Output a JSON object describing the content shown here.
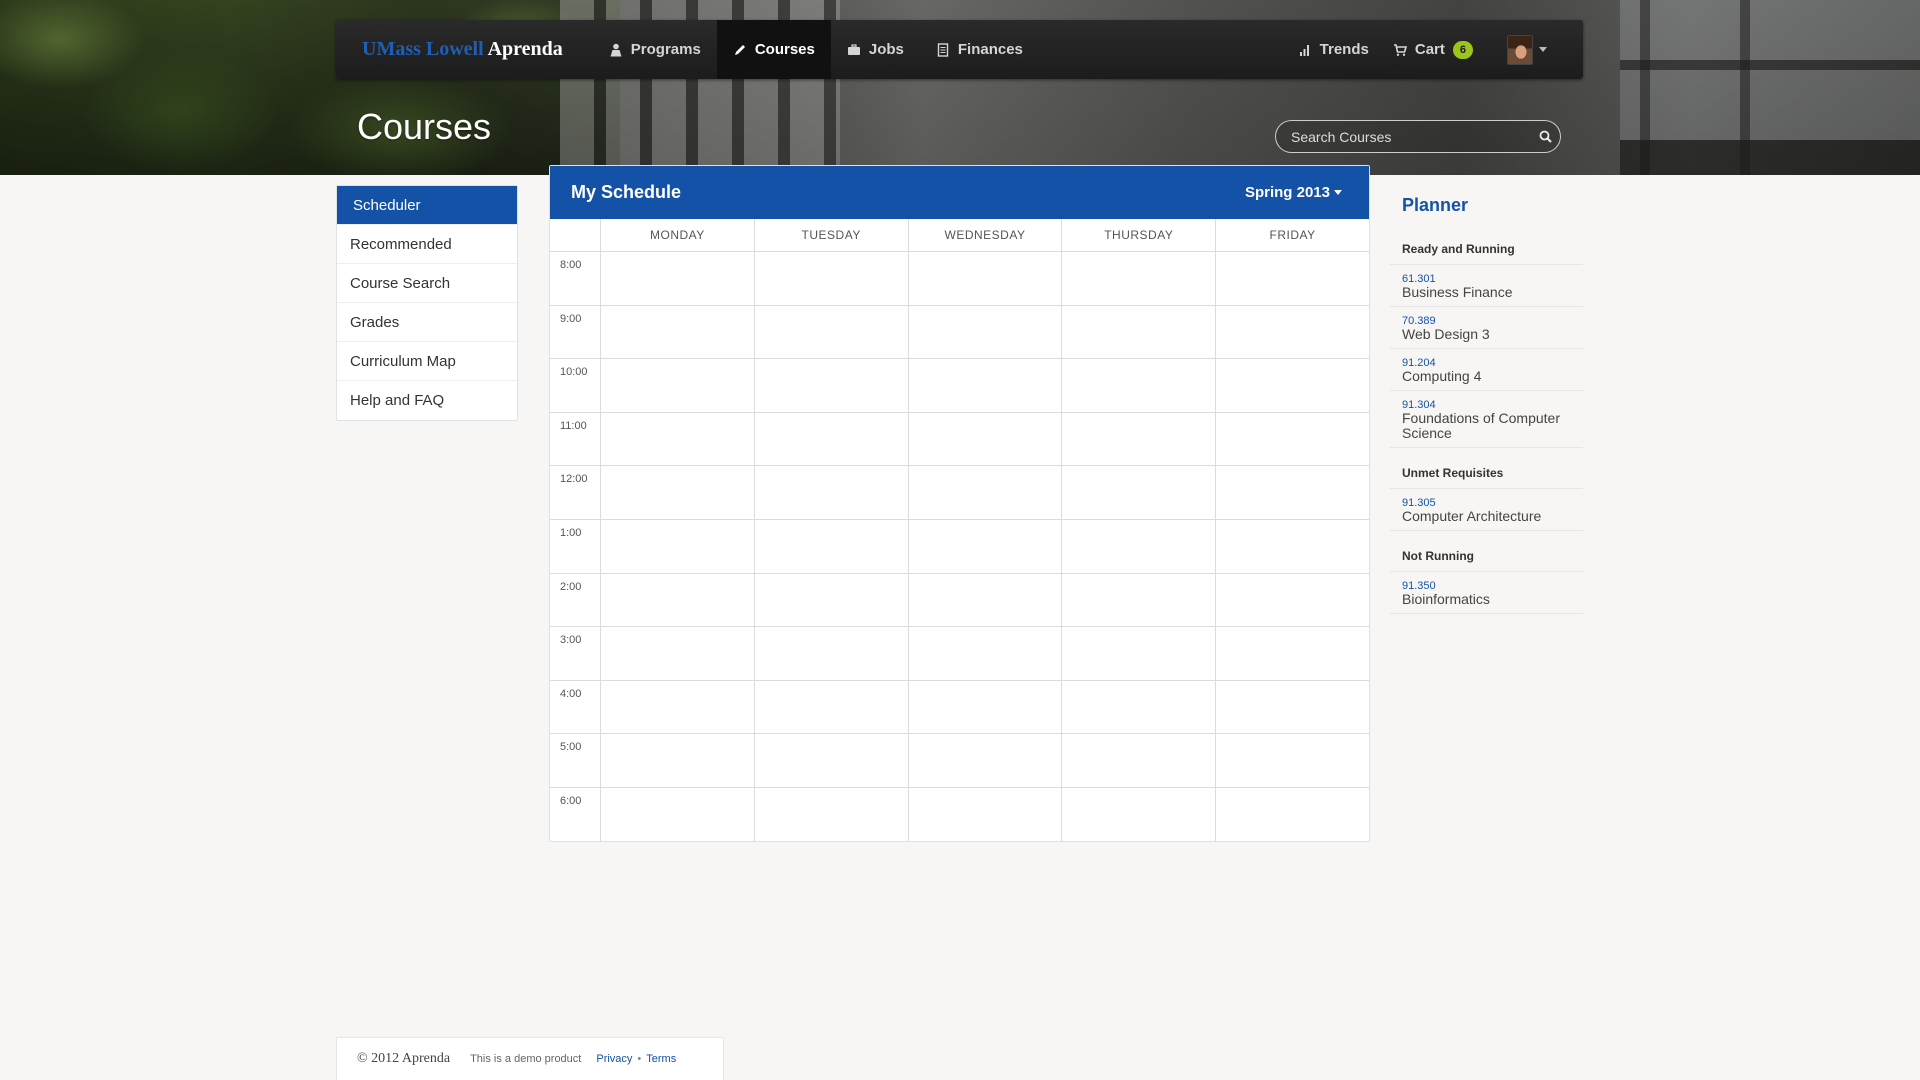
{
  "brand": {
    "part1": "UMass Lowell",
    "part2": "Aprenda"
  },
  "nav": {
    "items": [
      {
        "label": "Programs",
        "icon": "person-icon"
      },
      {
        "label": "Courses",
        "icon": "pencil-icon",
        "active": true
      },
      {
        "label": "Jobs",
        "icon": "briefcase-icon"
      },
      {
        "label": "Finances",
        "icon": "document-icon"
      }
    ],
    "right": {
      "trends": "Trends",
      "cart": "Cart",
      "cart_count": "6"
    }
  },
  "page": {
    "title": "Courses"
  },
  "search": {
    "placeholder": "Search Courses",
    "value": ""
  },
  "sidebar": {
    "items": [
      {
        "label": "Scheduler",
        "active": true
      },
      {
        "label": "Recommended"
      },
      {
        "label": "Course Search"
      },
      {
        "label": "Grades"
      },
      {
        "label": "Curriculum Map"
      },
      {
        "label": "Help and FAQ"
      }
    ]
  },
  "schedule": {
    "title": "My Schedule",
    "term": "Spring 2013",
    "days": [
      "MONDAY",
      "TUESDAY",
      "WEDNESDAY",
      "THURSDAY",
      "FRIDAY"
    ],
    "times": [
      "8:00",
      "9:00",
      "10:00",
      "11:00",
      "12:00",
      "1:00",
      "2:00",
      "3:00",
      "4:00",
      "5:00",
      "6:00"
    ]
  },
  "planner": {
    "title": "Planner",
    "sections": [
      {
        "heading": "Ready and Running",
        "courses": [
          {
            "code": "61.301",
            "name": "Business Finance"
          },
          {
            "code": "70.389",
            "name": "Web Design 3"
          },
          {
            "code": "91.204",
            "name": "Computing 4"
          },
          {
            "code": "91.304",
            "name": "Foundations of Computer Science"
          }
        ]
      },
      {
        "heading": "Unmet Requisites",
        "courses": [
          {
            "code": "91.305",
            "name": "Computer Architecture"
          }
        ]
      },
      {
        "heading": "Not Running",
        "courses": [
          {
            "code": "91.350",
            "name": "Bioinformatics"
          }
        ]
      }
    ]
  },
  "footer": {
    "copyright": "© 2012 Aprenda",
    "demo": "This is a demo product",
    "privacy": "Privacy",
    "separator": "•",
    "terms": "Terms"
  },
  "colors": {
    "accent": "#1452a8",
    "badge": "#9cc51b",
    "navbar": "#1c1c1c"
  }
}
